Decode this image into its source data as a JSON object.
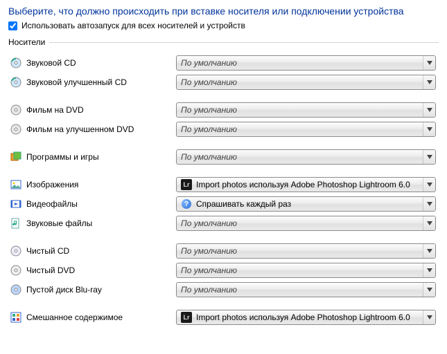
{
  "heading": "Выберите, что должно происходить при вставке носителя или подключении устройства",
  "checkbox_label": "Использовать автозапуск для всех носителей и устройств",
  "checkbox_checked": true,
  "group_title": "Носители",
  "default_text": "По умолчанию",
  "lightroom_text": "Import photos используя Adobe Photoshop Lightroom 6.0",
  "ask_text": "Спрашивать каждый раз",
  "rows": [
    {
      "icon": "audio-cd-icon",
      "label": "Звуковой CD",
      "combo": "default",
      "gap": false
    },
    {
      "icon": "audio-cd-icon",
      "label": "Звуковой улучшенный CD",
      "combo": "default",
      "gap": true
    },
    {
      "icon": "dvd-icon",
      "label": "Фильм на DVD",
      "combo": "default",
      "gap": false
    },
    {
      "icon": "dvd-icon",
      "label": "Фильм на улучшенном DVD",
      "combo": "default",
      "gap": true
    },
    {
      "icon": "software-icon",
      "label": "Программы и игры",
      "combo": "default",
      "gap": true
    },
    {
      "icon": "pictures-icon",
      "label": "Изображения",
      "combo": "lightroom",
      "gap": false
    },
    {
      "icon": "video-icon",
      "label": "Видеофайлы",
      "combo": "ask",
      "gap": false
    },
    {
      "icon": "music-file-icon",
      "label": "Звуковые файлы",
      "combo": "default",
      "gap": true
    },
    {
      "icon": "blank-cd-icon",
      "label": "Чистый CD",
      "combo": "default",
      "gap": false
    },
    {
      "icon": "blank-dvd-icon",
      "label": "Чистый DVD",
      "combo": "default",
      "gap": false
    },
    {
      "icon": "bluray-icon",
      "label": "Пустой диск Blu-ray",
      "combo": "default",
      "gap": true
    },
    {
      "icon": "mixed-icon",
      "label": "Смешанное содержимое",
      "combo": "lightroom",
      "gap": false
    }
  ]
}
